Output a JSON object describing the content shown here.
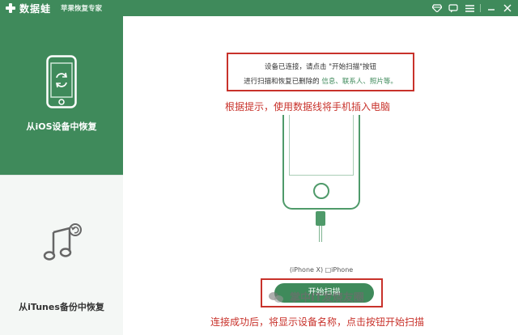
{
  "titlebar": {
    "app_name": "数据蛙",
    "subtitle": "苹果恢复专家",
    "icons": [
      "gem-icon",
      "chat-icon",
      "menu-icon",
      "minimize-icon",
      "close-icon"
    ]
  },
  "sidebar": {
    "items": [
      {
        "label": "从iOS设备中恢复",
        "icon": "phone-recover-icon",
        "active": true
      },
      {
        "label": "从iTunes备份中恢复",
        "icon": "music-backup-icon",
        "active": false
      }
    ]
  },
  "main": {
    "message_line1": "设备已连接，请点击 \"开始扫描\"按钮",
    "message_line2_prefix": "进行扫描和恢复已删除的 ",
    "message_line2_items": "信息、联系人、照片等。",
    "annotation_top": "根据提示，使用数据线将手机插入电脑",
    "device_name": "(iPhone X) □iPhone",
    "scan_button": "开始扫描",
    "annotation_bottom": "连接成功后，将显示设备名称，点击按钮开始扫描"
  },
  "watermark": {
    "text": "掌中IT发烧友圈"
  },
  "colors": {
    "brand_green": "#3f8a5b",
    "annotation_red": "#c8322b"
  }
}
